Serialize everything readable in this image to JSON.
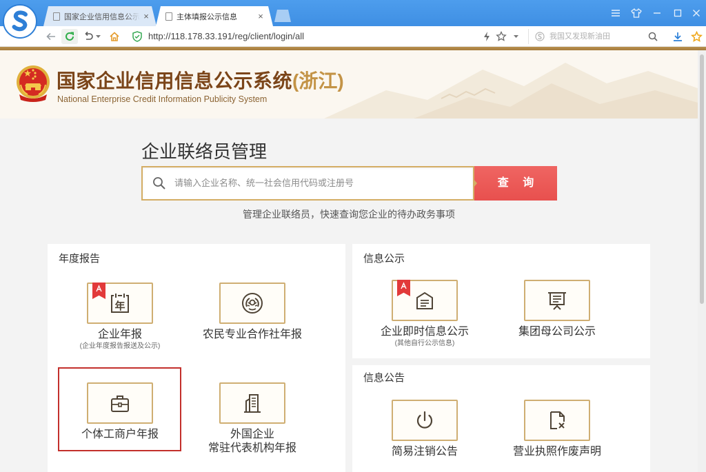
{
  "browser": {
    "tabs": [
      {
        "label": "国家企业信用信息公示系",
        "close": "×",
        "icon": "page-icon"
      },
      {
        "label": "主体填报公示信息",
        "close": "×",
        "icon": "page-icon"
      }
    ],
    "active_tab": 1,
    "url": "http://118.178.33.191/reg/client/login/all",
    "search_placeholder": "我国又发现新油田",
    "toolbar_icons": [
      "back-icon",
      "refresh-icon",
      "undo-icon",
      "home-icon",
      "security-shield-icon",
      "lightning-icon",
      "bookmark-star-icon",
      "dropdown-caret-icon",
      "search-icon",
      "download-icon",
      "favorites-star-icon"
    ],
    "window_controls": [
      "menu-icon",
      "skin-icon",
      "minimize-icon",
      "maximize-icon",
      "close-icon"
    ]
  },
  "header": {
    "title": "国家企业信用信息公示系统",
    "region": "(浙江)",
    "subtitle": "National Enterprise Credit Information Publicity System",
    "logo": "national-emblem-icon"
  },
  "contact_manager": {
    "heading": "企业联络员管理",
    "search_placeholder": "请输入企业名称、统一社会信用代码或注册号",
    "search_button": "查 询",
    "hint": "管理企业联络员，快速查询您企业的待办政务事项"
  },
  "panels": {
    "annual_report": {
      "title": "年度报告",
      "items": [
        {
          "label": "企业年报",
          "sublabel": "(企业年度报告报送及公示)",
          "icon": "annual-calendar-icon",
          "glyph": "年",
          "ribbon": true
        },
        {
          "label": "农民专业合作社年报",
          "icon": "cooperative-emblem-icon"
        },
        {
          "label": "个体工商户年报",
          "icon": "briefcase-icon",
          "highlighted": true
        },
        {
          "label": "外国企业",
          "label2": "常驻代表机构年报",
          "icon": "building-icon"
        }
      ]
    },
    "info_publicity": {
      "title": "信息公示",
      "items": [
        {
          "label": "企业即时信息公示",
          "sublabel": "(其他自行公示信息)",
          "icon": "notice-board-icon",
          "ribbon": true
        },
        {
          "label": "集团母公司公示",
          "icon": "easel-board-icon"
        }
      ]
    },
    "info_announcement": {
      "title": "信息公告",
      "items": [
        {
          "label": "简易注销公告",
          "icon": "power-icon"
        },
        {
          "label": "营业执照作废声明",
          "icon": "document-void-icon"
        }
      ]
    }
  },
  "colors": {
    "tabbar": "#3f8fe3",
    "gold": "#cfae72",
    "red": "#e8504e",
    "frame": "#c32f2b",
    "ribbon": "#e23a3a",
    "title": "#7b4519",
    "region": "#c39346",
    "rule": "#a57b3c"
  }
}
